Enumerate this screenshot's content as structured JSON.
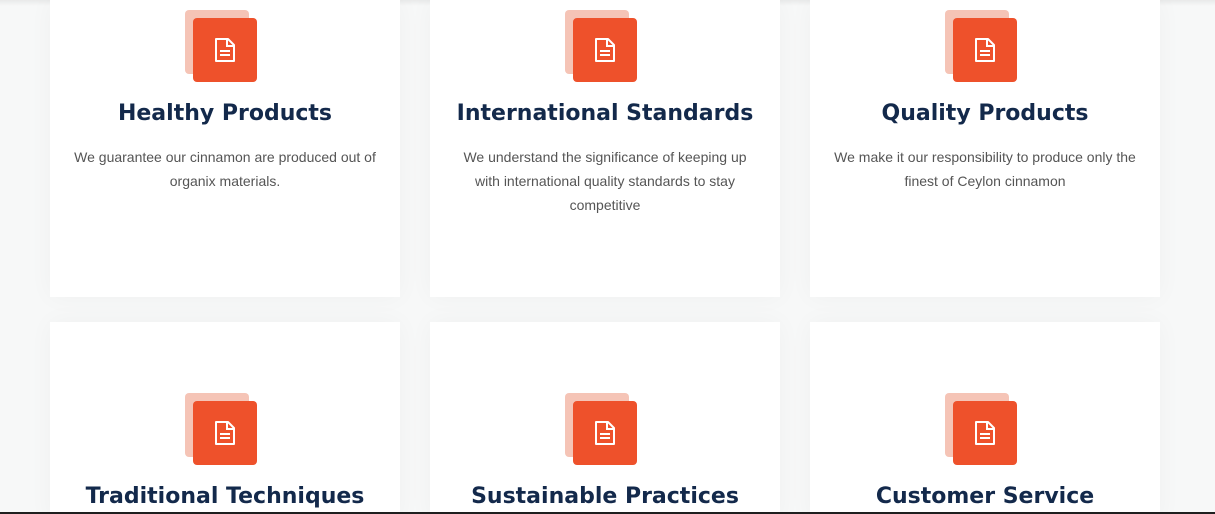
{
  "colors": {
    "accent": "#ee512b",
    "accent_light": "#f5c4b6",
    "heading": "#13294b",
    "body_text": "#555555",
    "background": "#f7f8f8",
    "card": "#ffffff"
  },
  "features": [
    {
      "icon": "document-icon",
      "title": "Healthy Products",
      "description": "We guarantee our cinnamon are produced out of organix materials."
    },
    {
      "icon": "document-icon",
      "title": "International Standards",
      "description": "We understand the significance of keeping up with international quality standards to stay competitive"
    },
    {
      "icon": "document-icon",
      "title": "Quality Products",
      "description": "We make it our responsibility to produce only the finest of Ceylon cinnamon"
    },
    {
      "icon": "document-icon",
      "title": "Traditional Techniques"
    },
    {
      "icon": "document-icon",
      "title": "Sustainable Practices"
    },
    {
      "icon": "document-icon",
      "title": "Customer Service"
    }
  ]
}
